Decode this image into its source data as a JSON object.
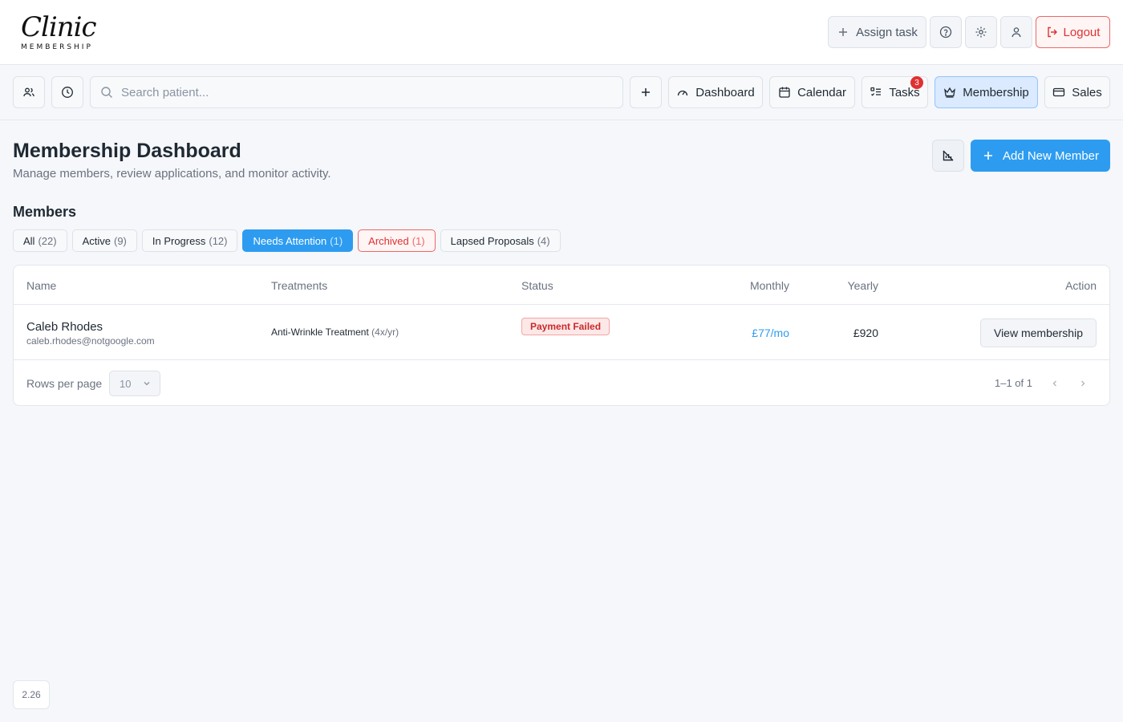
{
  "logo": {
    "script": "Clinic",
    "sub": "MEMBERSHIP"
  },
  "header": {
    "assign_task": "Assign task",
    "logout": "Logout"
  },
  "nav": {
    "search_placeholder": "Search patient...",
    "dashboard": "Dashboard",
    "calendar": "Calendar",
    "tasks": "Tasks",
    "tasks_badge": "3",
    "membership": "Membership",
    "sales": "Sales",
    "active_item": "Membership"
  },
  "page": {
    "title": "Membership Dashboard",
    "subtitle": "Manage members, review applications, and monitor activity.",
    "add_member": "Add New Member"
  },
  "members": {
    "title": "Members",
    "filters": [
      {
        "label": "All",
        "count": "(22)"
      },
      {
        "label": "Active",
        "count": "(9)"
      },
      {
        "label": "In Progress",
        "count": "(12)"
      },
      {
        "label": "Needs Attention",
        "count": "(1)"
      },
      {
        "label": "Archived",
        "count": "(1)"
      },
      {
        "label": "Lapsed Proposals",
        "count": "(4)"
      }
    ],
    "active_filter": "Needs Attention"
  },
  "table": {
    "columns": {
      "name": "Name",
      "treatments": "Treatments",
      "status": "Status",
      "monthly": "Monthly",
      "yearly": "Yearly",
      "action": "Action"
    },
    "rows": [
      {
        "name": "Caleb Rhodes",
        "email": "caleb.rhodes@notgoogle.com",
        "treatment": "Anti-Wrinkle Treatment",
        "frequency": "(4x/yr)",
        "status": "Payment Failed",
        "monthly": "£77/mo",
        "yearly": "£920",
        "action": "View membership"
      }
    ],
    "rows_per_page_label": "Rows per page",
    "rows_per_page": "10",
    "range": "1–1 of 1"
  },
  "version": "2.26",
  "colors": {
    "primary": "#2d9cf0",
    "danger": "#e03131",
    "active_nav_bg": "#dbeafe"
  }
}
